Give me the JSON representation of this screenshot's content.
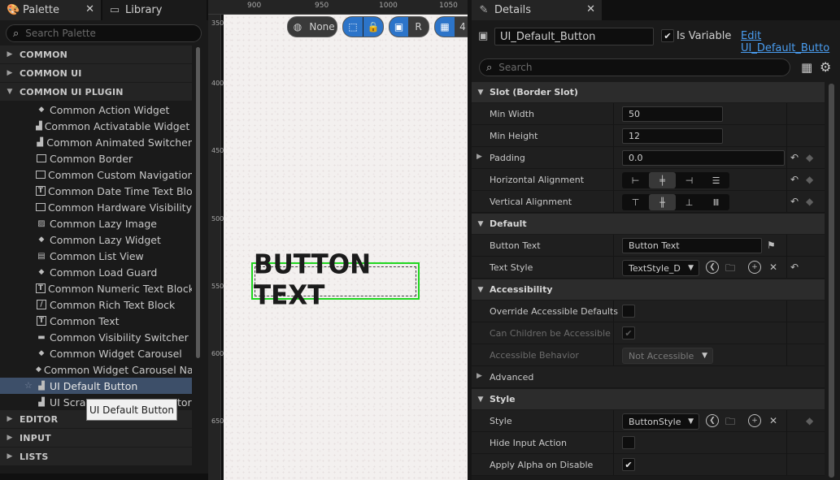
{
  "palette_tabs": {
    "palette": "Palette",
    "library": "Library"
  },
  "palette_search": {
    "placeholder": "Search Palette"
  },
  "categories": {
    "common": "COMMON",
    "common_ui": "COMMON UI",
    "common_ui_plugin": "COMMON UI PLUGIN",
    "editor": "EDITOR",
    "input": "INPUT",
    "lists": "LISTS"
  },
  "palette_items": [
    "Common Action Widget",
    "Common Activatable Widget Sv",
    "Common Animated Switcher",
    "Common Border",
    "Common Custom Navigation",
    "Common Date Time Text Block",
    "Common Hardware Visibility Bo",
    "Common Lazy Image",
    "Common Lazy Widget",
    "Common List View",
    "Common Load Guard",
    "Common Numeric Text Block",
    "Common Rich Text Block",
    "Common Text",
    "Common Visibility Switcher",
    "Common Widget Carousel",
    "Common Widget Carousel Nav",
    "UI Default Button",
    "UI Scra"
  ],
  "palette_item_partial": "tor",
  "tooltip": "UI Default Button",
  "canvas": {
    "ruler_top": [
      "900",
      "950",
      "1000",
      "1050"
    ],
    "ruler_left": [
      "350",
      "400",
      "450",
      "500",
      "550",
      "600",
      "650"
    ],
    "toolbar": {
      "world_label": "None",
      "r_label": "R",
      "grid_label": "4"
    },
    "button_text": "BUTTON TEXT"
  },
  "details": {
    "tab": "Details",
    "widget_name": "UI_Default_Button",
    "is_variable_label": "Is Variable",
    "edit_link": "Edit UI_Default_Butto",
    "search_placeholder": "Search",
    "sections": {
      "slot": "Slot (Border Slot)",
      "default": "Default",
      "accessibility": "Accessibility",
      "advanced": "Advanced",
      "style": "Style"
    },
    "props": {
      "min_width": {
        "label": "Min Width",
        "value": "50"
      },
      "min_height": {
        "label": "Min Height",
        "value": "12"
      },
      "padding": {
        "label": "Padding",
        "value": "0.0"
      },
      "h_align": {
        "label": "Horizontal Alignment"
      },
      "v_align": {
        "label": "Vertical Alignment"
      },
      "button_text": {
        "label": "Button Text",
        "value": "Button Text"
      },
      "text_style": {
        "label": "Text Style",
        "value": "TextStyle_D"
      },
      "override_access": {
        "label": "Override Accessible Defaults"
      },
      "can_children": {
        "label": "Can Children be Accessible"
      },
      "access_behavior": {
        "label": "Accessible Behavior",
        "value": "Not Accessible"
      },
      "style": {
        "label": "Style",
        "value": "ButtonStyle"
      },
      "hide_input": {
        "label": "Hide Input Action"
      },
      "apply_alpha": {
        "label": "Apply Alpha on Disable"
      }
    }
  }
}
